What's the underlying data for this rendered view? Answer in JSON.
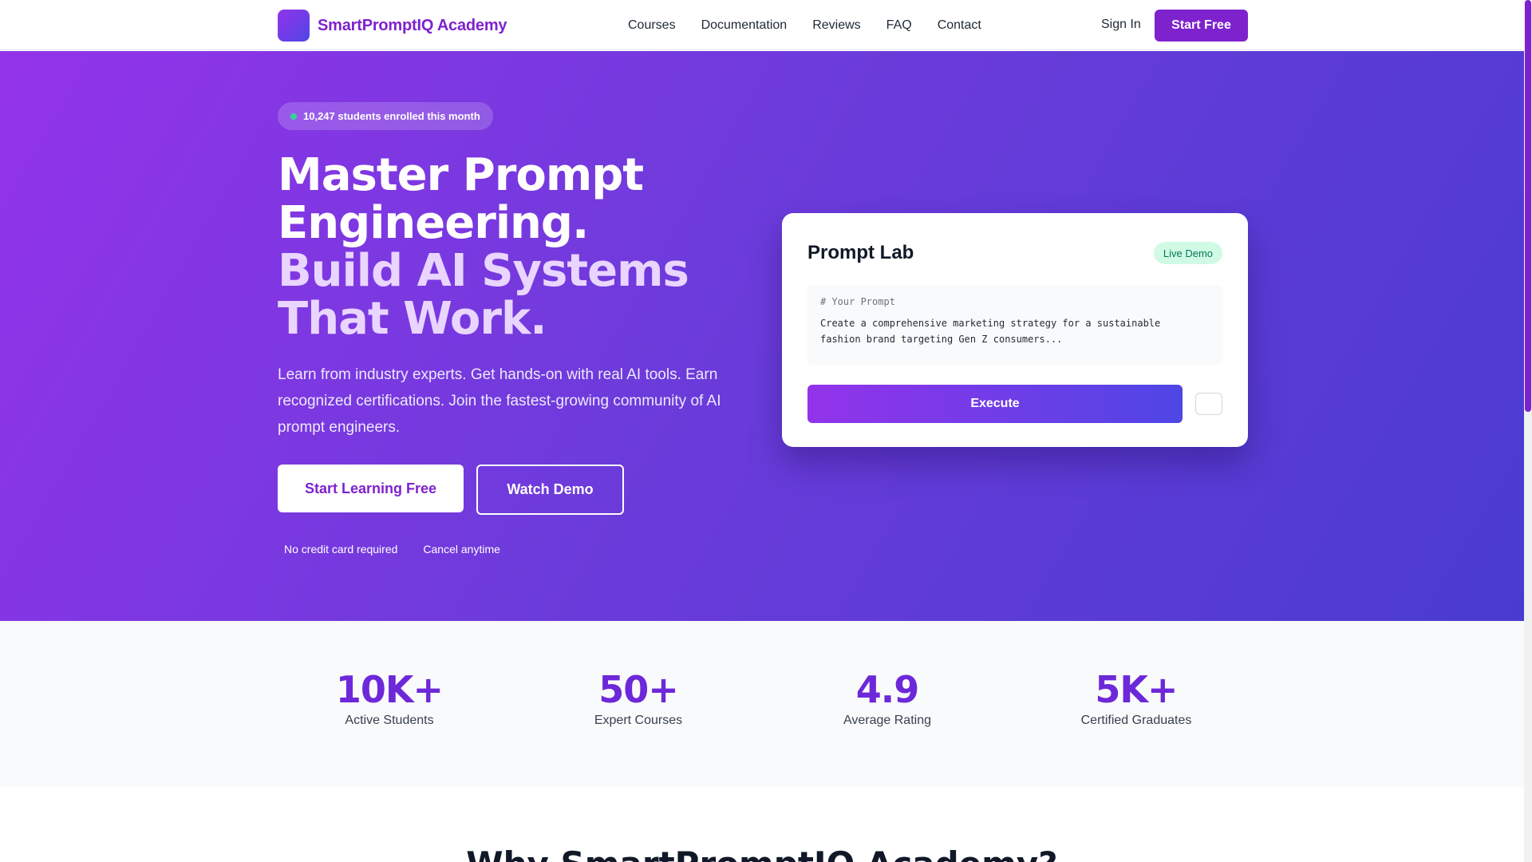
{
  "nav": {
    "brand": "SmartPromptIQ Academy",
    "links": [
      "Courses",
      "Documentation",
      "Reviews",
      "FAQ",
      "Contact"
    ],
    "sign_in": "Sign In",
    "start_free": "Start Free"
  },
  "hero": {
    "badge": "10,247 students enrolled this month",
    "headline_line1": "Master Prompt",
    "headline_line2": "Engineering.",
    "headline_line3": "Build AI Systems",
    "headline_line4": "That Work.",
    "subtext": "Learn from industry experts. Get hands-on with real AI tools. Earn recognized certifications. Join the fastest-growing community of AI prompt engineers.",
    "primary_cta": "Start Learning Free",
    "secondary_cta": "Watch Demo",
    "notes": [
      "No credit card required",
      "Cancel anytime"
    ]
  },
  "lab": {
    "title": "Prompt Lab",
    "badge": "Live Demo",
    "code_comment": "# Your Prompt",
    "code_line1": "Create a comprehensive marketing strategy for a sustainable",
    "code_line2": "fashion brand targeting Gen Z consumers...",
    "execute": "Execute"
  },
  "stats": [
    {
      "value": "10K+",
      "label": "Active Students"
    },
    {
      "value": "50+",
      "label": "Expert Courses"
    },
    {
      "value": "4.9",
      "label": "Average Rating"
    },
    {
      "value": "5K+",
      "label": "Certified Graduates"
    }
  ],
  "next_section_heading": "Why SmartPromptIQ Academy?",
  "colors": {
    "brand": "#7e22ce",
    "hero_start": "#9333ea",
    "hero_end": "#4a3bd0",
    "stat_value": "#6d28d9",
    "live_badge": "#d1fae5"
  }
}
